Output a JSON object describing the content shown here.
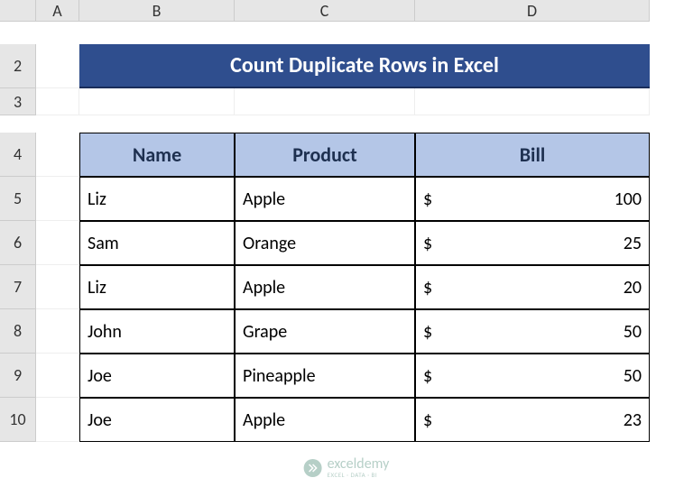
{
  "columns": [
    "A",
    "B",
    "C",
    "D"
  ],
  "rows": [
    "2",
    "3",
    "4",
    "5",
    "6",
    "7",
    "8",
    "9",
    "10"
  ],
  "title": "Count Duplicate Rows in Excel",
  "headers": {
    "name": "Name",
    "product": "Product",
    "bill": "Bill"
  },
  "currency": "$",
  "data": [
    {
      "name": "Liz",
      "product": "Apple",
      "bill": "100"
    },
    {
      "name": "Sam",
      "product": "Orange",
      "bill": "25"
    },
    {
      "name": "Liz",
      "product": "Apple",
      "bill": "20"
    },
    {
      "name": "John",
      "product": "Grape",
      "bill": "50"
    },
    {
      "name": "Joe",
      "product": "Pineapple",
      "bill": "50"
    },
    {
      "name": "Joe",
      "product": "Apple",
      "bill": "23"
    }
  ],
  "watermark": {
    "main": "exceldemy",
    "sub": "EXCEL · DATA · BI"
  },
  "chart_data": {
    "type": "table",
    "title": "Count Duplicate Rows in Excel",
    "columns": [
      "Name",
      "Product",
      "Bill"
    ],
    "rows": [
      [
        "Liz",
        "Apple",
        100
      ],
      [
        "Sam",
        "Orange",
        25
      ],
      [
        "Liz",
        "Apple",
        20
      ],
      [
        "John",
        "Grape",
        50
      ],
      [
        "Joe",
        "Pineapple",
        50
      ],
      [
        "Joe",
        "Apple",
        23
      ]
    ]
  }
}
